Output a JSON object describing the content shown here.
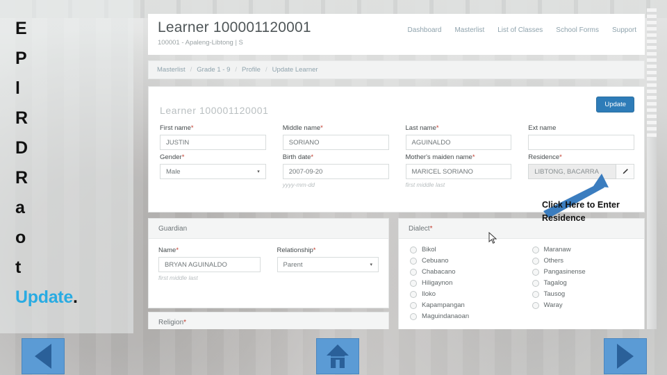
{
  "slide": {
    "caption_lines": [
      "Edit the",
      "Profile",
      "like",
      "Religion,",
      "Dialect,",
      "Residence",
      "and",
      "others…,",
      "then Click"
    ],
    "caption_accent": "Update",
    "caption_accent_tail": ".",
    "accent_color": "#29ABE2"
  },
  "app": {
    "title": "Learner 100001120001",
    "subtitle": "100001 - Apaleng-Libtong | S",
    "nav": [
      {
        "label": "Dashboard"
      },
      {
        "label": "Masterlist"
      },
      {
        "label": "List of Classes"
      },
      {
        "label": "School Forms"
      },
      {
        "label": "Support"
      }
    ],
    "breadcrumb": [
      "Masterlist",
      "Grade 1 - 9",
      "Profile",
      "Update Learner"
    ],
    "breadcrumb_separator": "/"
  },
  "main_card": {
    "title": "Learner 100001120001",
    "update_label": "Update",
    "fields": {
      "first_name": {
        "label": "First name",
        "required": "*",
        "value": "JUSTIN"
      },
      "middle_name": {
        "label": "Middle name",
        "required": "*",
        "value": "SORIANO"
      },
      "last_name": {
        "label": "Last name",
        "required": "*",
        "value": "AGUINALDO"
      },
      "ext_name": {
        "label": "Ext name",
        "required": "",
        "value": ""
      },
      "gender": {
        "label": "Gender",
        "required": "*",
        "value": "Male",
        "caret": "▾"
      },
      "birth_date": {
        "label": "Birth date",
        "required": "*",
        "value": "2007-09-20",
        "hint": "yyyy-mm-dd"
      },
      "mothers_maiden_name": {
        "label": "Mother's maiden name",
        "required": "*",
        "value": "MARICEL SORIANO",
        "hint": "first middle last"
      },
      "residence": {
        "label": "Residence",
        "required": "*",
        "value": "LIBTONG, BACARRA",
        "edit_icon": "pencil-icon"
      }
    }
  },
  "guardian_card": {
    "heading": "Guardian",
    "name": {
      "label": "Name",
      "required": "*",
      "value": "BRYAN AGUINALDO",
      "hint": "first middle last"
    },
    "relationship": {
      "label": "Relationship",
      "required": "*",
      "value": "Parent",
      "caret": "▾"
    }
  },
  "religion_card": {
    "heading": "Religion",
    "required": "*"
  },
  "dialect_card": {
    "heading": "Dialect",
    "required": "*",
    "column_left": [
      "Bikol",
      "Cebuano",
      "Chabacano",
      "Hiligaynon",
      "Iloko",
      "Kapampangan",
      "Maguindanaoan"
    ],
    "column_right": [
      "Maranaw",
      "Others",
      "Pangasinense",
      "Tagalog",
      "Tausog",
      "Waray"
    ]
  },
  "annotation": {
    "callout_line1": "Click Here to Enter",
    "callout_line2": "Residence",
    "arrow_color": "#3b7dbf"
  },
  "bottom_nav": {
    "back": "back-arrow",
    "home": "home-icon",
    "next": "next-arrow",
    "button_color": "#5B9BD5"
  }
}
